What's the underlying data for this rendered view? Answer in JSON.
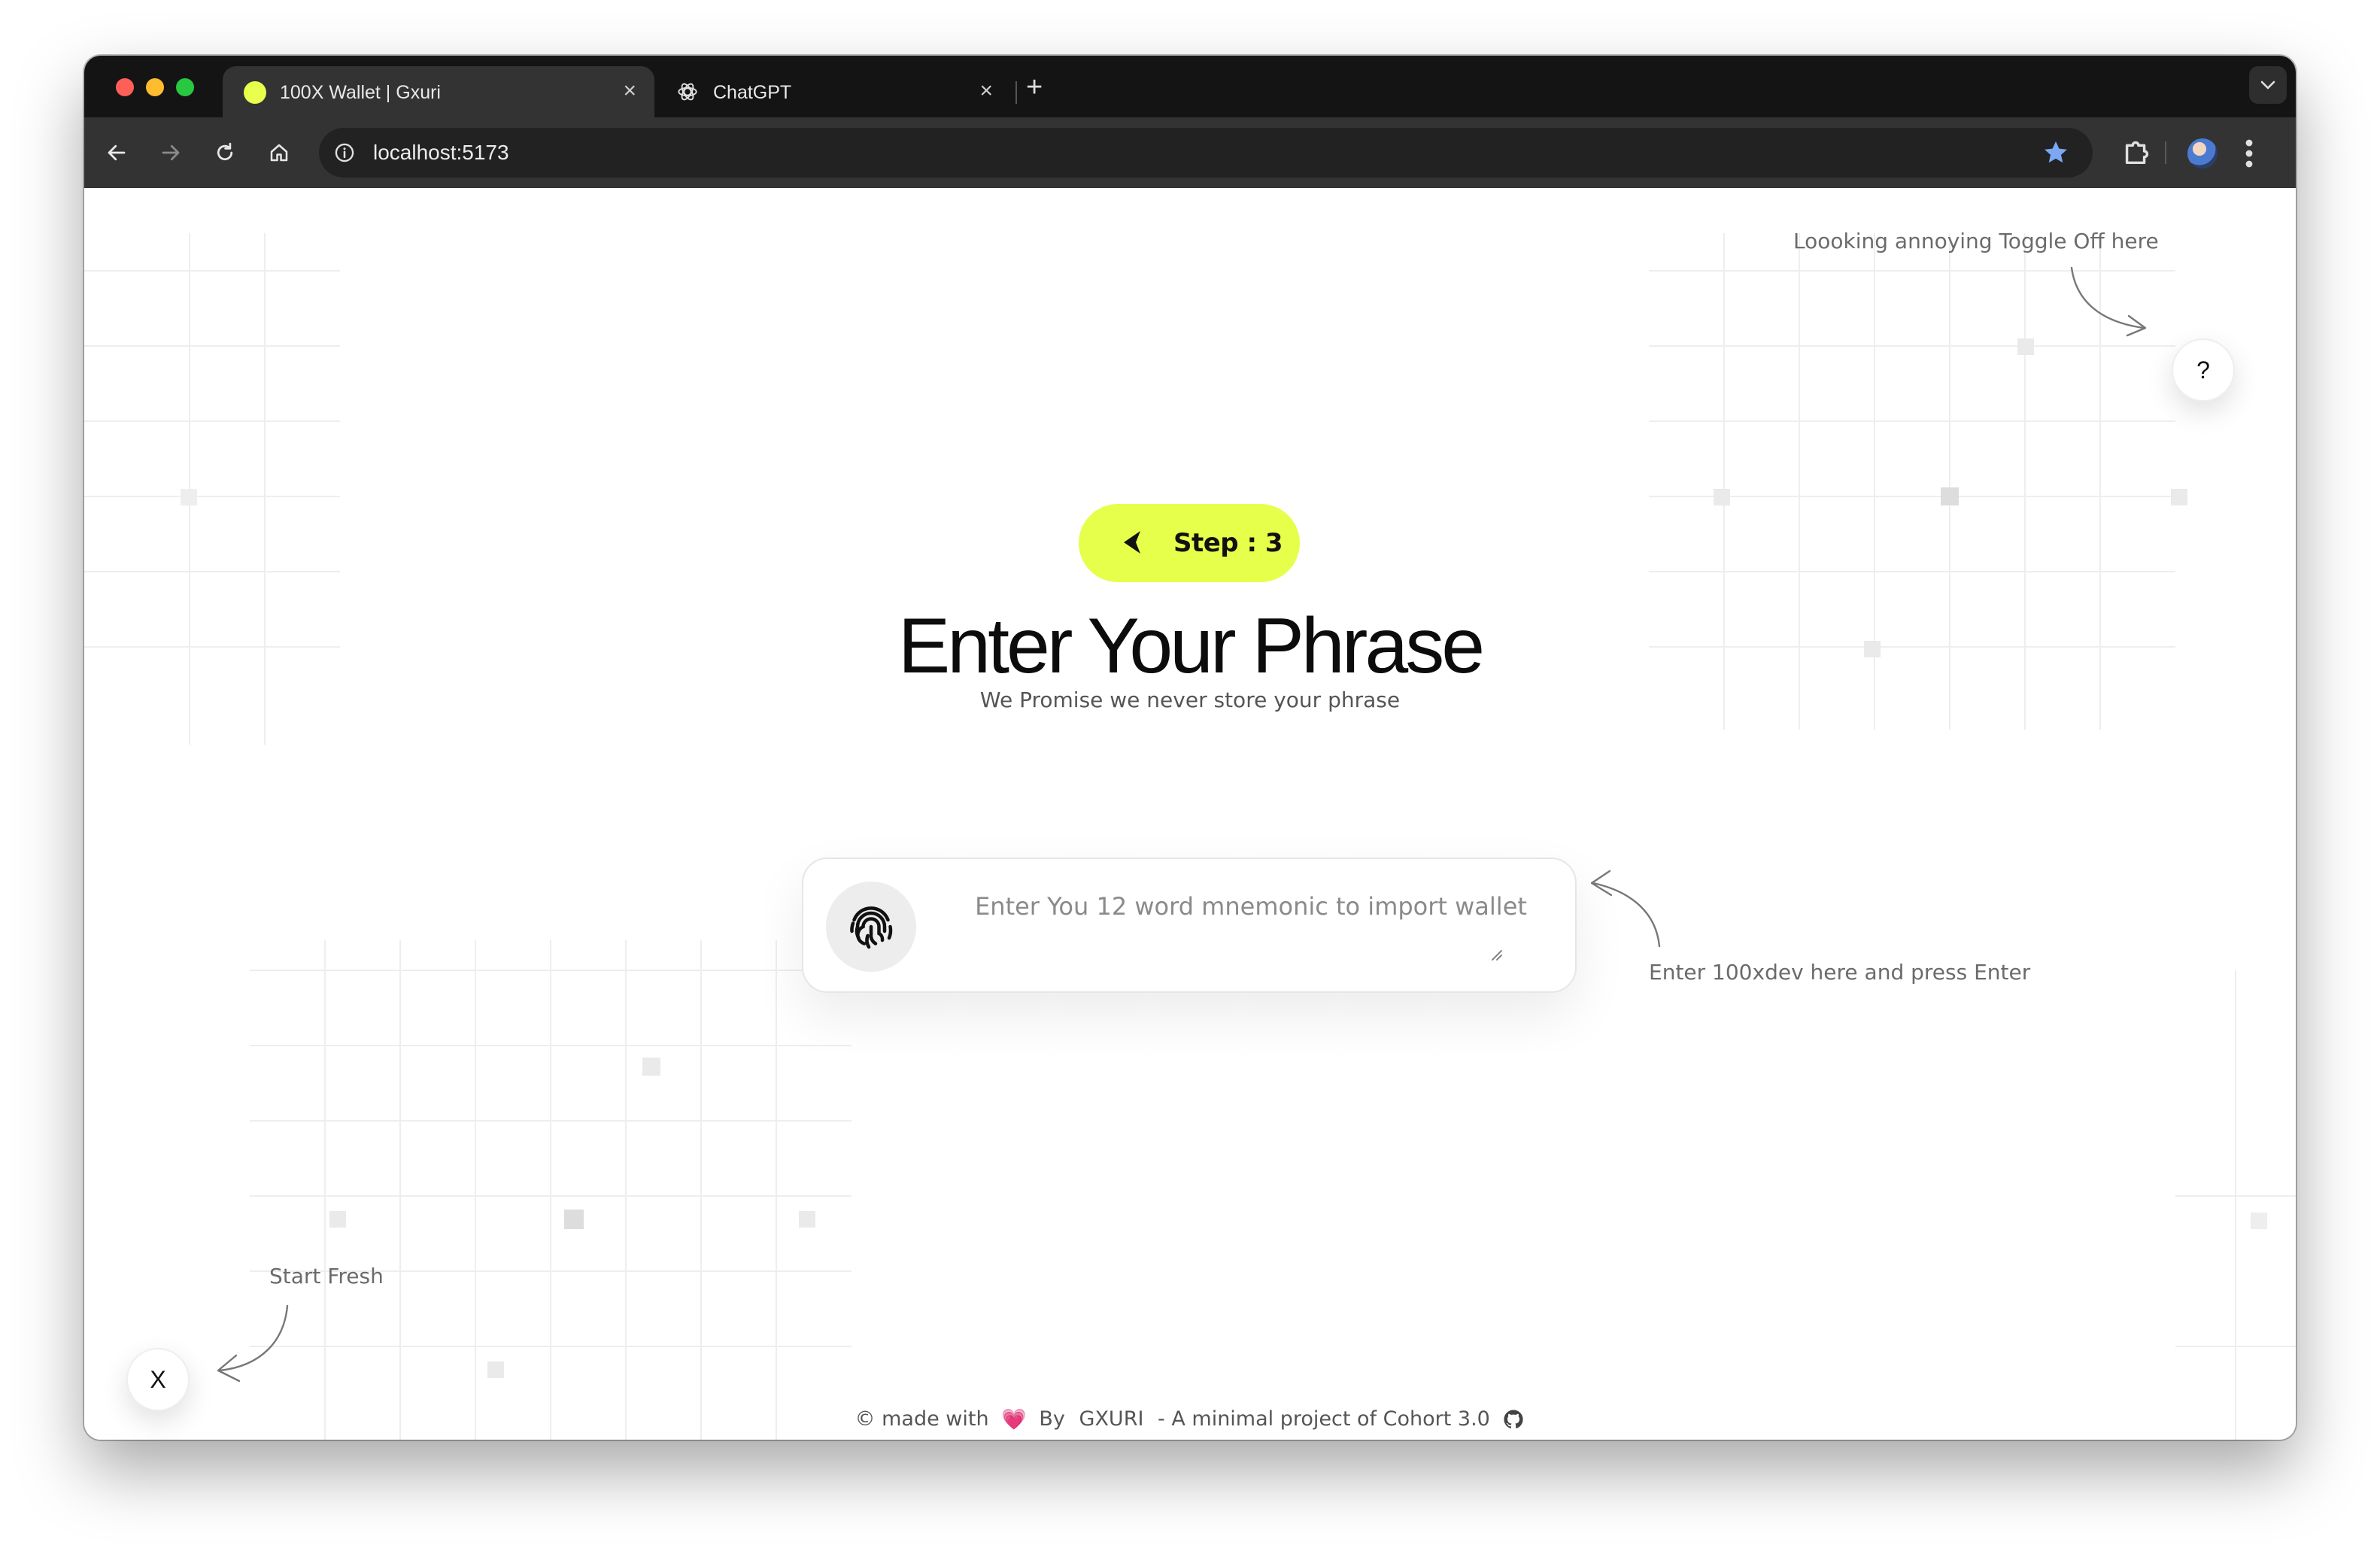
{
  "browser": {
    "tabs": [
      {
        "title": "100X Wallet | Gxuri",
        "active": true,
        "favicon": "yellow-dot-icon"
      },
      {
        "title": "ChatGPT",
        "active": false,
        "favicon": "openai-icon"
      }
    ],
    "tab_close_glyph": "×",
    "new_tab_glyph": "+",
    "url": "localhost:5173"
  },
  "page": {
    "step_label": "Step : 3",
    "title": "Enter Your Phrase",
    "subtitle": "We Promise we never store your phrase",
    "mnemonic_placeholder": "Enter You 12 word mnemonic to import wallet",
    "mnemonic_value": "",
    "help_hint": "Loooking annoying Toggle Off here",
    "help_button": "?",
    "enter_hint": "Enter 100xdev here and press Enter",
    "reset_hint": "Start Fresh",
    "reset_button": "X",
    "footer": {
      "made_with": "© made with",
      "heart": "💗",
      "by": "By",
      "author": "GXURI",
      "tagline": "- A minimal project of Cohort 3.0"
    }
  },
  "colors": {
    "accent": "#e6ff4a",
    "tab_bar": "#141414",
    "toolbar": "#333333"
  }
}
